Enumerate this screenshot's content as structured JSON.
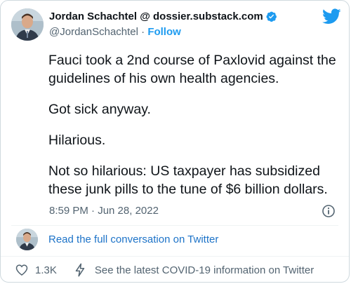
{
  "author": {
    "name": "Jordan Schachtel @ dossier.substack.com",
    "handle": "@JordanSchachtel",
    "separator": "·",
    "follow_label": "Follow"
  },
  "tweet": {
    "paragraphs": [
      "Fauci took a 2nd course of Paxlovid against the guidelines of his own health agencies.",
      "Got sick anyway.",
      "Hilarious.",
      "Not so hilarious: US taxpayer has subsidized these junk pills to the tune of $6 billion dollars."
    ],
    "timestamp": "8:59 PM · Jun 28, 2022"
  },
  "conversation": {
    "link_label": "Read the full conversation on Twitter"
  },
  "actions": {
    "like_count": "1.3K",
    "covid_label": "See the latest COVID-19 information on Twitter"
  },
  "colors": {
    "twitter_blue": "#1d9bf0",
    "text_primary": "#0f1419",
    "text_secondary": "#536471",
    "border": "#cfd9de"
  },
  "icons": [
    "twitter-bird-icon",
    "verified-badge-icon",
    "info-icon",
    "heart-icon",
    "bolt-icon"
  ]
}
